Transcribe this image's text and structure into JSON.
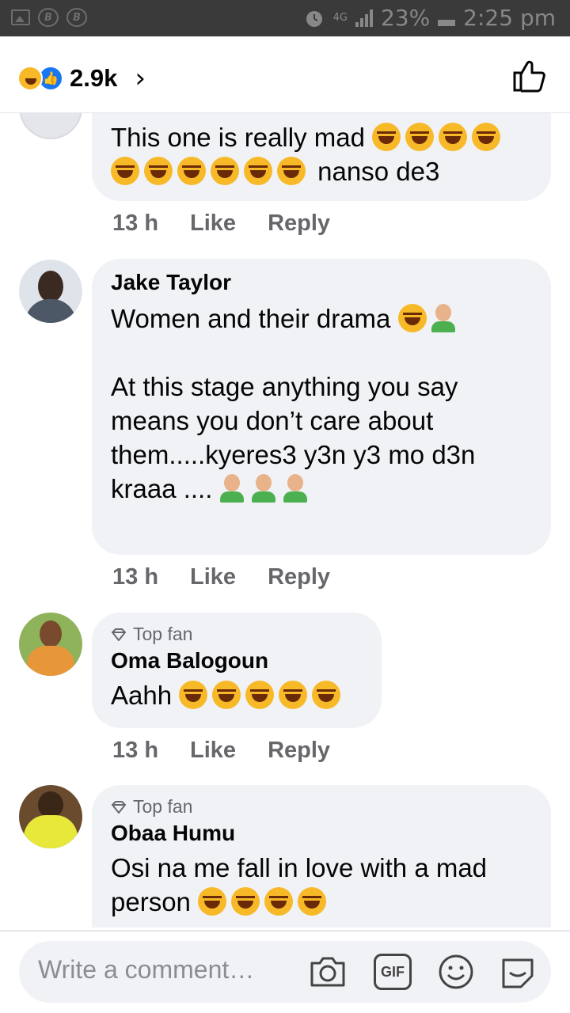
{
  "status_bar": {
    "network": "4G",
    "battery": "23%",
    "time": "2:25 pm"
  },
  "header": {
    "reaction_count": "2.9k"
  },
  "comments": [
    {
      "name": "",
      "top_fan": "",
      "text": "This one is really mad",
      "line2": "nanso de3",
      "time": "13 h",
      "like": "Like",
      "reply": "Reply"
    },
    {
      "name": "Jake Taylor",
      "text": "Women and their drama",
      "text2": "At this stage anything you say means you don’t care about them.....kyeres3 y3n y3 mo d3n kraaa ....",
      "time": "13 h",
      "like": "Like",
      "reply": "Reply"
    },
    {
      "name": "Oma Balogoun",
      "top_fan": "Top fan",
      "text": "Aahh",
      "time": "13 h",
      "like": "Like",
      "reply": "Reply"
    },
    {
      "name": "Obaa Humu",
      "top_fan": "Top fan",
      "text": "Osi na me fall in love with a mad person"
    }
  ],
  "composer": {
    "placeholder": "Write a comment…",
    "gif_label": "GIF"
  },
  "colors": {
    "bubble": "#f0f2f5",
    "meta": "#65676b",
    "like_blue": "#1877f2",
    "haha_yellow": "#f7b928"
  },
  "icons": [
    "image-icon",
    "b-badge-icon",
    "alarm-icon",
    "signal-icon",
    "battery-icon",
    "haha-reaction-icon",
    "like-reaction-icon",
    "chevron-right-icon",
    "thumbs-up-icon",
    "camera-icon",
    "gif-icon",
    "smiley-icon",
    "sticker-icon"
  ]
}
